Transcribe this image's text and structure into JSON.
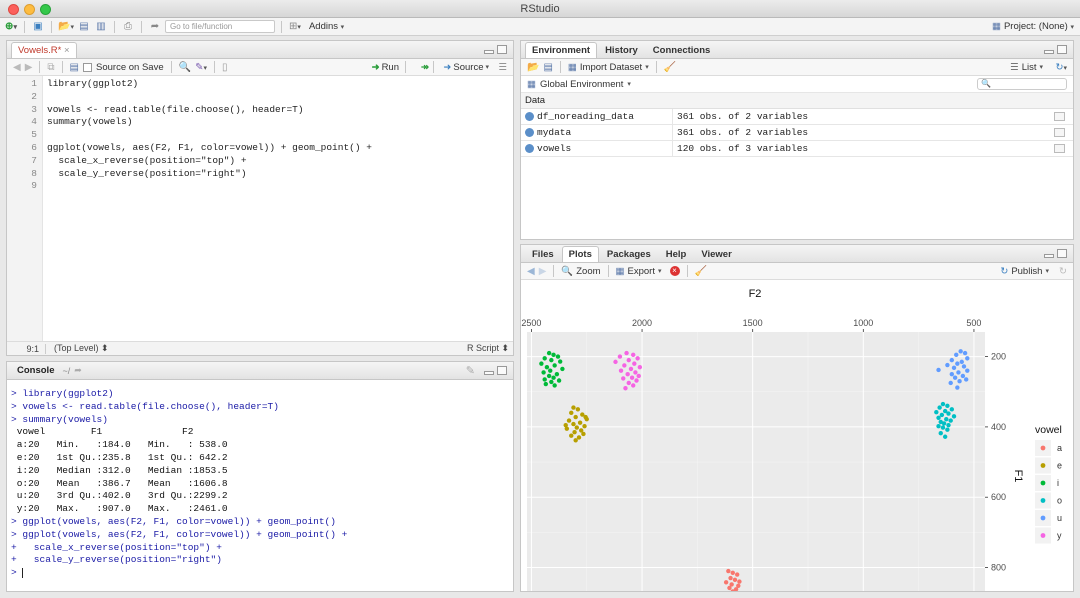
{
  "window": {
    "title": "RStudio"
  },
  "toolbar": {
    "goto_placeholder": "Go to file/function",
    "addins_label": "Addins",
    "project_label": "Project: (None)"
  },
  "editor": {
    "tab_label": "Vowels.R*",
    "source_on_save_label": "Source on Save",
    "run_label": "Run",
    "source_label": "Source",
    "line_numbers": [
      "1",
      "2",
      "3",
      "4",
      "5",
      "6",
      "7",
      "8",
      "9"
    ],
    "lines": [
      "library(ggplot2)",
      "",
      "vowels <- read.table(file.choose(), header=T)",
      "summary(vowels)",
      "",
      "ggplot(vowels, aes(F2, F1, color=vowel)) + geom_point() +",
      "  scale_x_reverse(position=\"top\") +",
      "  scale_y_reverse(position=\"right\")",
      ""
    ],
    "status_position": "9:1",
    "status_scope": "(Top Level) ⬍",
    "status_type": "R Script ⬍"
  },
  "console": {
    "tab_label": "Console",
    "path": "~/",
    "lines": [
      {
        "t": "cmd",
        "s": "> library(ggplot2)"
      },
      {
        "t": "cmd",
        "s": "> vowels <- read.table(file.choose(), header=T)"
      },
      {
        "t": "cmd",
        "s": "> summary(vowels)"
      },
      {
        "t": "out",
        "s": " vowel        F1              F2        "
      },
      {
        "t": "out",
        "s": " a:20   Min.   :184.0   Min.   : 538.0  "
      },
      {
        "t": "out",
        "s": " e:20   1st Qu.:235.8   1st Qu.: 642.2  "
      },
      {
        "t": "out",
        "s": " i:20   Median :312.0   Median :1853.5  "
      },
      {
        "t": "out",
        "s": " o:20   Mean   :386.7   Mean   :1606.8  "
      },
      {
        "t": "out",
        "s": " u:20   3rd Qu.:402.0   3rd Qu.:2299.2  "
      },
      {
        "t": "out",
        "s": " y:20   Max.   :907.0   Max.   :2461.0  "
      },
      {
        "t": "cmd",
        "s": "> ggplot(vowels, aes(F2, F1, color=vowel)) + geom_point()"
      },
      {
        "t": "cmd",
        "s": "> ggplot(vowels, aes(F2, F1, color=vowel)) + geom_point() +"
      },
      {
        "t": "cmd",
        "s": "+   scale_x_reverse(position=\"top\") +"
      },
      {
        "t": "cmd",
        "s": "+   scale_y_reverse(position=\"right\")"
      },
      {
        "t": "cmd",
        "s": "> "
      }
    ]
  },
  "environment": {
    "tabs": [
      "Environment",
      "History",
      "Connections"
    ],
    "import_label": "Import Dataset",
    "list_label": "List",
    "global_env_label": "Global Environment",
    "section_label": "Data",
    "rows": [
      {
        "name": "df_noreading_data",
        "value": "361 obs. of 2 variables"
      },
      {
        "name": "mydata",
        "value": "361 obs. of 2 variables"
      },
      {
        "name": "vowels",
        "value": "120 obs. of 3 variables"
      }
    ]
  },
  "plots": {
    "tabs": [
      "Files",
      "Plots",
      "Packages",
      "Help",
      "Viewer"
    ],
    "zoom_label": "Zoom",
    "export_label": "Export",
    "publish_label": "Publish"
  },
  "chart_data": {
    "type": "scatter",
    "xlabel": "F2",
    "ylabel": "F1",
    "x_reversed": true,
    "y_reversed": true,
    "x_axis_position": "top",
    "y_axis_position": "right",
    "xlim": [
      2520,
      450
    ],
    "ylim": [
      130,
      955
    ],
    "x_ticks": [
      2500,
      2000,
      1500,
      1000,
      500
    ],
    "y_ticks": [
      200,
      400,
      600,
      800
    ],
    "legend_title": "vowel",
    "legend_position": "right",
    "panel_background": "#ebebeb",
    "series": [
      {
        "name": "a",
        "color": "#F8766D",
        "points": [
          [
            1610,
            810
          ],
          [
            1590,
            815
          ],
          [
            1570,
            820
          ],
          [
            1600,
            830
          ],
          [
            1580,
            835
          ],
          [
            1620,
            842
          ],
          [
            1595,
            848
          ],
          [
            1565,
            852
          ],
          [
            1605,
            858
          ],
          [
            1575,
            862
          ],
          [
            1590,
            868
          ],
          [
            1615,
            875
          ],
          [
            1585,
            880
          ],
          [
            1600,
            886
          ],
          [
            1570,
            890
          ],
          [
            1595,
            897
          ],
          [
            1580,
            900
          ],
          [
            1605,
            905
          ],
          [
            1590,
            907
          ],
          [
            1560,
            840
          ]
        ]
      },
      {
        "name": "e",
        "color": "#B79F00",
        "points": [
          [
            2310,
            345
          ],
          [
            2290,
            350
          ],
          [
            2320,
            360
          ],
          [
            2270,
            365
          ],
          [
            2300,
            372
          ],
          [
            2250,
            378
          ],
          [
            2330,
            382
          ],
          [
            2280,
            388
          ],
          [
            2310,
            392
          ],
          [
            2260,
            398
          ],
          [
            2295,
            402
          ],
          [
            2340,
            405
          ],
          [
            2275,
            410
          ],
          [
            2305,
            415
          ],
          [
            2265,
            420
          ],
          [
            2320,
            425
          ],
          [
            2285,
            430
          ],
          [
            2300,
            438
          ],
          [
            2255,
            372
          ],
          [
            2345,
            395
          ]
        ]
      },
      {
        "name": "i",
        "color": "#00BA38",
        "points": [
          [
            2420,
            190
          ],
          [
            2400,
            195
          ],
          [
            2380,
            200
          ],
          [
            2440,
            205
          ],
          [
            2410,
            210
          ],
          [
            2370,
            214
          ],
          [
            2455,
            220
          ],
          [
            2395,
            225
          ],
          [
            2430,
            230
          ],
          [
            2360,
            235
          ],
          [
            2415,
            240
          ],
          [
            2445,
            245
          ],
          [
            2385,
            250
          ],
          [
            2420,
            255
          ],
          [
            2400,
            260
          ],
          [
            2440,
            265
          ],
          [
            2375,
            268
          ],
          [
            2410,
            272
          ],
          [
            2435,
            278
          ],
          [
            2395,
            282
          ]
        ]
      },
      {
        "name": "o",
        "color": "#00BFC4",
        "points": [
          [
            640,
            335
          ],
          [
            620,
            340
          ],
          [
            655,
            345
          ],
          [
            600,
            350
          ],
          [
            630,
            355
          ],
          [
            670,
            358
          ],
          [
            615,
            362
          ],
          [
            645,
            366
          ],
          [
            590,
            370
          ],
          [
            660,
            374
          ],
          [
            625,
            378
          ],
          [
            605,
            382
          ],
          [
            650,
            386
          ],
          [
            635,
            390
          ],
          [
            615,
            395
          ],
          [
            660,
            398
          ],
          [
            640,
            402
          ],
          [
            620,
            408
          ],
          [
            650,
            418
          ],
          [
            630,
            428
          ]
        ]
      },
      {
        "name": "u",
        "color": "#619CFF",
        "points": [
          [
            560,
            185
          ],
          [
            540,
            190
          ],
          [
            580,
            195
          ],
          [
            530,
            205
          ],
          [
            600,
            210
          ],
          [
            555,
            215
          ],
          [
            575,
            220
          ],
          [
            620,
            224
          ],
          [
            545,
            228
          ],
          [
            590,
            232
          ],
          [
            660,
            238
          ],
          [
            530,
            240
          ],
          [
            570,
            245
          ],
          [
            600,
            250
          ],
          [
            550,
            255
          ],
          [
            585,
            260
          ],
          [
            535,
            265
          ],
          [
            565,
            270
          ],
          [
            605,
            275
          ],
          [
            575,
            288
          ]
        ]
      },
      {
        "name": "y",
        "color": "#F564E3",
        "points": [
          [
            2070,
            190
          ],
          [
            2040,
            195
          ],
          [
            2100,
            200
          ],
          [
            2020,
            205
          ],
          [
            2060,
            210
          ],
          [
            2120,
            215
          ],
          [
            2035,
            220
          ],
          [
            2080,
            225
          ],
          [
            2010,
            230
          ],
          [
            2050,
            235
          ],
          [
            2095,
            240
          ],
          [
            2030,
            245
          ],
          [
            2065,
            250
          ],
          [
            2015,
            255
          ],
          [
            2045,
            260
          ],
          [
            2085,
            262
          ],
          [
            2025,
            268
          ],
          [
            2060,
            275
          ],
          [
            2040,
            282
          ],
          [
            2075,
            290
          ]
        ]
      }
    ]
  }
}
